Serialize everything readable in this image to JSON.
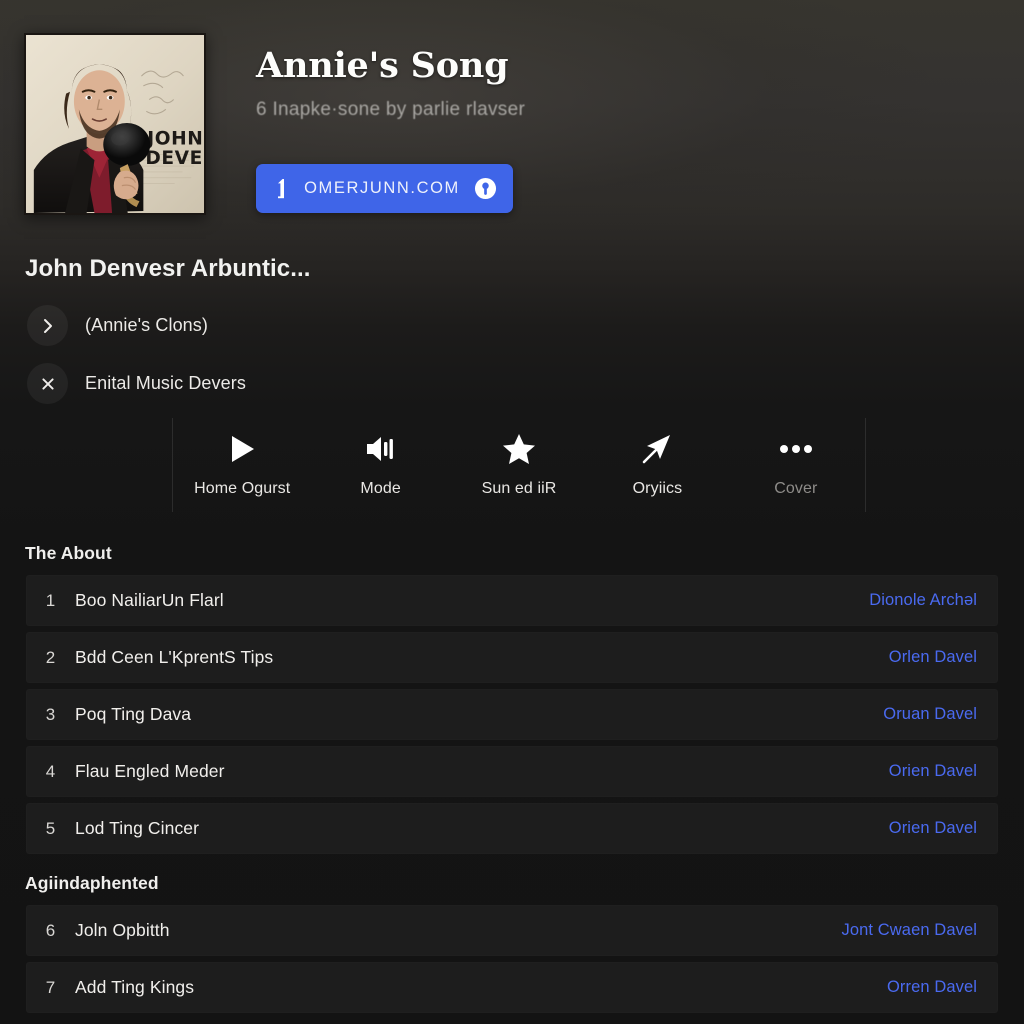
{
  "header": {
    "title": "Annie's Song",
    "subtitle": "6 Inapke·sone by parlie rlavser",
    "cta": {
      "label": "OMERJUNN.COM",
      "left_icon": "note-glyph-icon",
      "right_icon": "account-badge-icon",
      "color": "#3f65e8"
    },
    "album_art": {
      "alt": "John Dever album cover",
      "artist_text_line1": "JOHN",
      "artist_text_line2": "DEVER"
    }
  },
  "meta": {
    "artist_heading": "John Denvesr Arbuntic...",
    "rows": [
      {
        "icon": "chevron-right-icon",
        "label": "(Annie's Clons)"
      },
      {
        "icon": "close-x-icon",
        "label": "Enital Music Devers"
      }
    ]
  },
  "toolbar": {
    "items": [
      {
        "icon": "play-icon",
        "label": "Home Ogurst",
        "dim": false
      },
      {
        "icon": "speaker-icon",
        "label": "Mode",
        "dim": false
      },
      {
        "icon": "star-icon",
        "label": "Sun ed iiR",
        "dim": false
      },
      {
        "icon": "send-icon",
        "label": "Oryiics",
        "dim": false
      },
      {
        "icon": "ellipsis-icon",
        "label": "Cover",
        "dim": true
      }
    ]
  },
  "sections": [
    {
      "title": "The About",
      "tracks": [
        {
          "num": "1",
          "name": "Boo NailiarUn Flarl",
          "link": "Dionole Archəl"
        },
        {
          "num": "2",
          "name": "Bdd Ceen L'KprentS Tips",
          "link": "Orlen Davel"
        },
        {
          "num": "3",
          "name": "Poq Ting Dava",
          "link": "Oruan Davel"
        },
        {
          "num": "4",
          "name": "Flau Engled Meder",
          "link": "Orien Davel"
        },
        {
          "num": "5",
          "name": "Lod Ting Cincer",
          "link": "Orien Davel"
        }
      ]
    },
    {
      "title": "Agiindaphented",
      "tracks": [
        {
          "num": "6",
          "name": "Joln Opbitth",
          "link": "Jont Cwaen Davel"
        },
        {
          "num": "7",
          "name": "Add Ting Kings",
          "link": "Orren Davel"
        }
      ]
    }
  ],
  "colors": {
    "accent_blue": "#3f65e8",
    "link_blue": "#4a6af0",
    "row_bg": "#1d1d1d",
    "page_bg": "#141414"
  }
}
